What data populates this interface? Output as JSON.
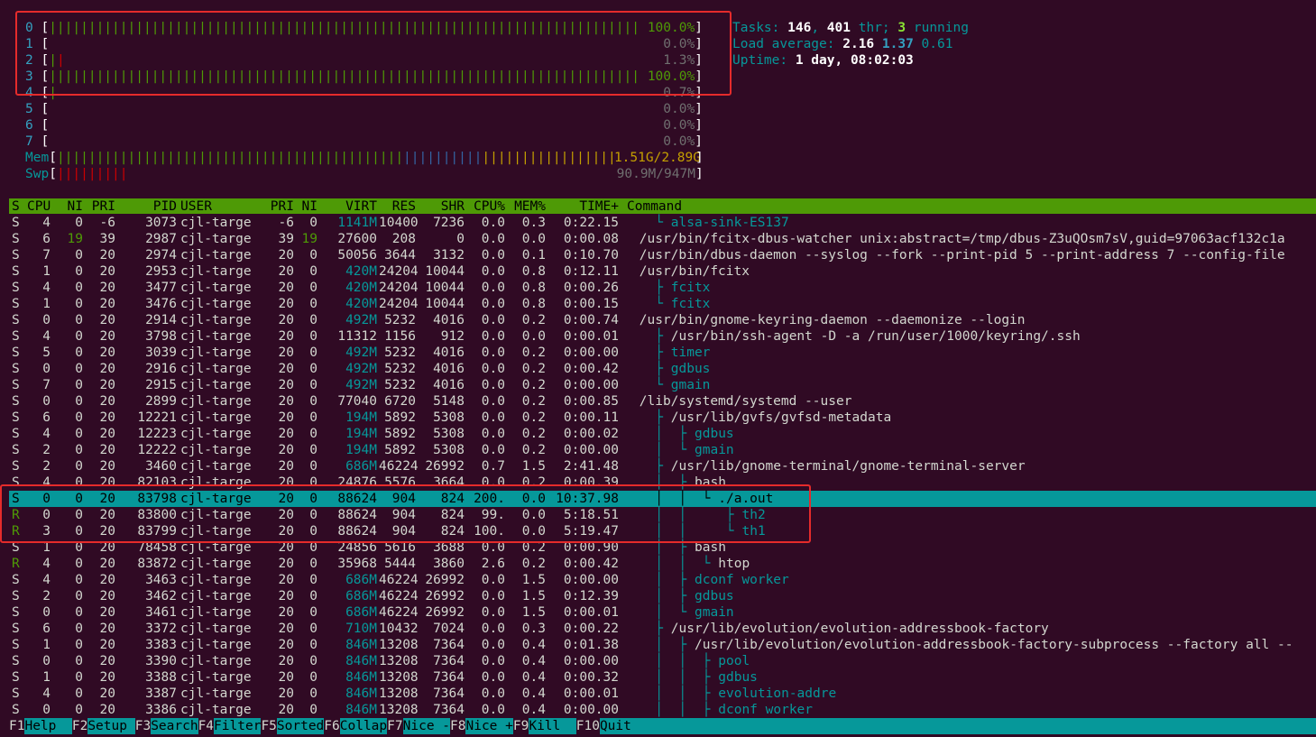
{
  "cpus": [
    {
      "id": "0",
      "pct": "100.0%",
      "fill": 0.99,
      "bar": "||||||||||||||||||||||||||||||||||||||||||||||||||||||||||||||||||||||||||||||||||||||||||||||||||"
    },
    {
      "id": "1",
      "pct": "0.0%",
      "fill": 0,
      "bar": ""
    },
    {
      "id": "2",
      "pct": "1.3%",
      "fill": 0.02,
      "bar": "||"
    },
    {
      "id": "3",
      "pct": "100.0%",
      "fill": 0.99,
      "bar": "||||||||||||||||||||||||||||||||||||||||||||||||||||||||||||||||||||||||||||||||||||||||||||||||||"
    },
    {
      "id": "4",
      "pct": "0.7%",
      "fill": 0.01,
      "bar": "|"
    },
    {
      "id": "5",
      "pct": "0.0%",
      "fill": 0,
      "bar": ""
    },
    {
      "id": "6",
      "pct": "0.0%",
      "fill": 0,
      "bar": ""
    },
    {
      "id": "7",
      "pct": "0.0%",
      "fill": 0,
      "bar": ""
    }
  ],
  "mem": {
    "label": "Mem",
    "value": "1.51G/2.89G",
    "fill": 0.52
  },
  "swp": {
    "label": "Swp",
    "value": "90.9M/947M",
    "fill": 0.1
  },
  "tasks": {
    "label": "Tasks:",
    "count": "146",
    "sep": ", ",
    "thr": "401",
    "thr_label": " thr; ",
    "running": "3",
    "running_label": " running"
  },
  "load": {
    "label": "Load average:",
    "v1": "2.16",
    "v2": "1.37",
    "v3": "0.61"
  },
  "uptime": {
    "label": "Uptime:",
    "value": "1 day, 08:02:03"
  },
  "header": [
    "S",
    "CPU",
    "NI",
    "PRI",
    "PID",
    "USER",
    "PRI",
    "NI",
    "VIRT",
    "RES",
    "SHR",
    "CPU%",
    "MEM%",
    "TIME+",
    "Command"
  ],
  "rows": [
    {
      "s": "S",
      "cpu": "4",
      "ni": "0",
      "pri": "-6",
      "pid": "3073",
      "user": "cjl-targe",
      "pri2": "-6",
      "ni2": "0",
      "virt": "1141M",
      "res": "10400",
      "shr": "7236",
      "cpup": "0.0",
      "memp": "0.3",
      "time": "0:22.15",
      "tree": "   └ ",
      "cmd": "alsa-sink-ES137",
      "cmdc": "cyn"
    },
    {
      "s": "S",
      "cpu": "6",
      "ni": "19",
      "pri": "39",
      "pid": "2987",
      "user": "cjl-targe",
      "pri2": "39",
      "ni2": "19",
      "virt": "27600",
      "res": "208",
      "shr": "0",
      "cpup": "0.0",
      "memp": "0.0",
      "time": "0:00.08",
      "tree": " ",
      "cmd": "/usr/bin/fcitx-dbus-watcher unix:abstract=/tmp/dbus-Z3uQOsm7sV,guid=97063acf132c1a",
      "cmdc": ""
    },
    {
      "s": "S",
      "cpu": "7",
      "ni": "0",
      "pri": "20",
      "pid": "2974",
      "user": "cjl-targe",
      "pri2": "20",
      "ni2": "0",
      "virt": "50056",
      "res": "3644",
      "shr": "3132",
      "cpup": "0.0",
      "memp": "0.1",
      "time": "0:10.70",
      "tree": " ",
      "cmd": "/usr/bin/dbus-daemon --syslog --fork --print-pid 5 --print-address 7 --config-file",
      "cmdc": ""
    },
    {
      "s": "S",
      "cpu": "1",
      "ni": "0",
      "pri": "20",
      "pid": "2953",
      "user": "cjl-targe",
      "pri2": "20",
      "ni2": "0",
      "virt": "420M",
      "res": "24204",
      "shr": "10044",
      "cpup": "0.0",
      "memp": "0.8",
      "time": "0:12.11",
      "tree": " ",
      "cmd": "/usr/bin/fcitx",
      "cmdc": ""
    },
    {
      "s": "S",
      "cpu": "4",
      "ni": "0",
      "pri": "20",
      "pid": "3477",
      "user": "cjl-targe",
      "pri2": "20",
      "ni2": "0",
      "virt": "420M",
      "res": "24204",
      "shr": "10044",
      "cpup": "0.0",
      "memp": "0.8",
      "time": "0:00.26",
      "tree": "   ├ ",
      "cmd": "fcitx",
      "cmdc": "cyn"
    },
    {
      "s": "S",
      "cpu": "1",
      "ni": "0",
      "pri": "20",
      "pid": "3476",
      "user": "cjl-targe",
      "pri2": "20",
      "ni2": "0",
      "virt": "420M",
      "res": "24204",
      "shr": "10044",
      "cpup": "0.0",
      "memp": "0.8",
      "time": "0:00.15",
      "tree": "   └ ",
      "cmd": "fcitx",
      "cmdc": "cyn"
    },
    {
      "s": "S",
      "cpu": "0",
      "ni": "0",
      "pri": "20",
      "pid": "2914",
      "user": "cjl-targe",
      "pri2": "20",
      "ni2": "0",
      "virt": "492M",
      "res": "5232",
      "shr": "4016",
      "cpup": "0.0",
      "memp": "0.2",
      "time": "0:00.74",
      "tree": " ",
      "cmd": "/usr/bin/gnome-keyring-daemon --daemonize --login",
      "cmdc": ""
    },
    {
      "s": "S",
      "cpu": "4",
      "ni": "0",
      "pri": "20",
      "pid": "3798",
      "user": "cjl-targe",
      "pri2": "20",
      "ni2": "0",
      "virt": "11312",
      "res": "1156",
      "shr": "912",
      "cpup": "0.0",
      "memp": "0.0",
      "time": "0:00.01",
      "tree": "   ├ ",
      "cmd": "/usr/bin/ssh-agent -D -a /run/user/1000/keyring/.ssh",
      "cmdc": ""
    },
    {
      "s": "S",
      "cpu": "5",
      "ni": "0",
      "pri": "20",
      "pid": "3039",
      "user": "cjl-targe",
      "pri2": "20",
      "ni2": "0",
      "virt": "492M",
      "res": "5232",
      "shr": "4016",
      "cpup": "0.0",
      "memp": "0.2",
      "time": "0:00.00",
      "tree": "   ├ ",
      "cmd": "timer",
      "cmdc": "cyn"
    },
    {
      "s": "S",
      "cpu": "0",
      "ni": "0",
      "pri": "20",
      "pid": "2916",
      "user": "cjl-targe",
      "pri2": "20",
      "ni2": "0",
      "virt": "492M",
      "res": "5232",
      "shr": "4016",
      "cpup": "0.0",
      "memp": "0.2",
      "time": "0:00.42",
      "tree": "   ├ ",
      "cmd": "gdbus",
      "cmdc": "cyn"
    },
    {
      "s": "S",
      "cpu": "7",
      "ni": "0",
      "pri": "20",
      "pid": "2915",
      "user": "cjl-targe",
      "pri2": "20",
      "ni2": "0",
      "virt": "492M",
      "res": "5232",
      "shr": "4016",
      "cpup": "0.0",
      "memp": "0.2",
      "time": "0:00.00",
      "tree": "   └ ",
      "cmd": "gmain",
      "cmdc": "cyn"
    },
    {
      "s": "S",
      "cpu": "0",
      "ni": "0",
      "pri": "20",
      "pid": "2899",
      "user": "cjl-targe",
      "pri2": "20",
      "ni2": "0",
      "virt": "77040",
      "res": "6720",
      "shr": "5148",
      "cpup": "0.0",
      "memp": "0.2",
      "time": "0:00.85",
      "tree": " ",
      "cmd": "/lib/systemd/systemd --user",
      "cmdc": ""
    },
    {
      "s": "S",
      "cpu": "6",
      "ni": "0",
      "pri": "20",
      "pid": "12221",
      "user": "cjl-targe",
      "pri2": "20",
      "ni2": "0",
      "virt": "194M",
      "res": "5892",
      "shr": "5308",
      "cpup": "0.0",
      "memp": "0.2",
      "time": "0:00.11",
      "tree": "   ├ ",
      "cmd": "/usr/lib/gvfs/gvfsd-metadata",
      "cmdc": ""
    },
    {
      "s": "S",
      "cpu": "4",
      "ni": "0",
      "pri": "20",
      "pid": "12223",
      "user": "cjl-targe",
      "pri2": "20",
      "ni2": "0",
      "virt": "194M",
      "res": "5892",
      "shr": "5308",
      "cpup": "0.0",
      "memp": "0.2",
      "time": "0:00.02",
      "tree": "   │  ├ ",
      "cmd": "gdbus",
      "cmdc": "cyn"
    },
    {
      "s": "S",
      "cpu": "2",
      "ni": "0",
      "pri": "20",
      "pid": "12222",
      "user": "cjl-targe",
      "pri2": "20",
      "ni2": "0",
      "virt": "194M",
      "res": "5892",
      "shr": "5308",
      "cpup": "0.0",
      "memp": "0.2",
      "time": "0:00.00",
      "tree": "   │  └ ",
      "cmd": "gmain",
      "cmdc": "cyn"
    },
    {
      "s": "S",
      "cpu": "2",
      "ni": "0",
      "pri": "20",
      "pid": "3460",
      "user": "cjl-targe",
      "pri2": "20",
      "ni2": "0",
      "virt": "686M",
      "res": "46224",
      "shr": "26992",
      "cpup": "0.7",
      "memp": "1.5",
      "time": "2:41.48",
      "tree": "   ├ ",
      "cmd": "/usr/lib/gnome-terminal/gnome-terminal-server",
      "cmdc": ""
    },
    {
      "s": "S",
      "cpu": "4",
      "ni": "0",
      "pri": "20",
      "pid": "82103",
      "user": "cjl-targe",
      "pri2": "20",
      "ni2": "0",
      "virt": "24876",
      "res": "5576",
      "shr": "3664",
      "cpup": "0.0",
      "memp": "0.2",
      "time": "0:00.39",
      "tree": "   │  ├ ",
      "cmd": "bash",
      "cmdc": "",
      "strike": true
    },
    {
      "s": "S",
      "cpu": "0",
      "ni": "0",
      "pri": "20",
      "pid": "83798",
      "user": "cjl-targe",
      "pri2": "20",
      "ni2": "0",
      "virt": "88624",
      "res": "904",
      "shr": "824",
      "cpup": "200.",
      "memp": "0.0",
      "time": "10:37.98",
      "tree": "   │  │  └ ",
      "cmd": "./a.out",
      "cmdc": "",
      "sel": true
    },
    {
      "s": "R",
      "cpu": "0",
      "ni": "0",
      "pri": "20",
      "pid": "83800",
      "user": "cjl-targe",
      "pri2": "20",
      "ni2": "0",
      "virt": "88624",
      "res": "904",
      "shr": "824",
      "cpup": "99.",
      "memp": "0.0",
      "time": "5:18.51",
      "tree": "   │  │     ├ ",
      "cmd": "th2",
      "cmdc": "cyn"
    },
    {
      "s": "R",
      "cpu": "3",
      "ni": "0",
      "pri": "20",
      "pid": "83799",
      "user": "cjl-targe",
      "pri2": "20",
      "ni2": "0",
      "virt": "88624",
      "res": "904",
      "shr": "824",
      "cpup": "100.",
      "memp": "0.0",
      "time": "5:19.47",
      "tree": "   │  │     └ ",
      "cmd": "th1",
      "cmdc": "cyn"
    },
    {
      "s": "S",
      "cpu": "1",
      "ni": "0",
      "pri": "20",
      "pid": "78458",
      "user": "cjl-targe",
      "pri2": "20",
      "ni2": "0",
      "virt": "24856",
      "res": "5616",
      "shr": "3688",
      "cpup": "0.0",
      "memp": "0.2",
      "time": "0:00.90",
      "tree": "   │  ├ ",
      "cmd": "bash",
      "cmdc": ""
    },
    {
      "s": "R",
      "cpu": "4",
      "ni": "0",
      "pri": "20",
      "pid": "83872",
      "user": "cjl-targe",
      "pri2": "20",
      "ni2": "0",
      "virt": "35968",
      "res": "5444",
      "shr": "3860",
      "cpup": "2.6",
      "memp": "0.2",
      "time": "0:00.42",
      "tree": "   │  │  └ ",
      "cmd": "htop",
      "cmdc": ""
    },
    {
      "s": "S",
      "cpu": "4",
      "ni": "0",
      "pri": "20",
      "pid": "3463",
      "user": "cjl-targe",
      "pri2": "20",
      "ni2": "0",
      "virt": "686M",
      "res": "46224",
      "shr": "26992",
      "cpup": "0.0",
      "memp": "1.5",
      "time": "0:00.00",
      "tree": "   │  ├ ",
      "cmd": "dconf worker",
      "cmdc": "cyn"
    },
    {
      "s": "S",
      "cpu": "2",
      "ni": "0",
      "pri": "20",
      "pid": "3462",
      "user": "cjl-targe",
      "pri2": "20",
      "ni2": "0",
      "virt": "686M",
      "res": "46224",
      "shr": "26992",
      "cpup": "0.0",
      "memp": "1.5",
      "time": "0:12.39",
      "tree": "   │  ├ ",
      "cmd": "gdbus",
      "cmdc": "cyn"
    },
    {
      "s": "S",
      "cpu": "0",
      "ni": "0",
      "pri": "20",
      "pid": "3461",
      "user": "cjl-targe",
      "pri2": "20",
      "ni2": "0",
      "virt": "686M",
      "res": "46224",
      "shr": "26992",
      "cpup": "0.0",
      "memp": "1.5",
      "time": "0:00.01",
      "tree": "   │  └ ",
      "cmd": "gmain",
      "cmdc": "cyn"
    },
    {
      "s": "S",
      "cpu": "6",
      "ni": "0",
      "pri": "20",
      "pid": "3372",
      "user": "cjl-targe",
      "pri2": "20",
      "ni2": "0",
      "virt": "710M",
      "res": "10432",
      "shr": "7024",
      "cpup": "0.0",
      "memp": "0.3",
      "time": "0:00.22",
      "tree": "   ├ ",
      "cmd": "/usr/lib/evolution/evolution-addressbook-factory",
      "cmdc": ""
    },
    {
      "s": "S",
      "cpu": "1",
      "ni": "0",
      "pri": "20",
      "pid": "3383",
      "user": "cjl-targe",
      "pri2": "20",
      "ni2": "0",
      "virt": "846M",
      "res": "13208",
      "shr": "7364",
      "cpup": "0.0",
      "memp": "0.4",
      "time": "0:01.38",
      "tree": "   │  ├ ",
      "cmd": "/usr/lib/evolution/evolution-addressbook-factory-subprocess --factory all --",
      "cmdc": ""
    },
    {
      "s": "S",
      "cpu": "0",
      "ni": "0",
      "pri": "20",
      "pid": "3390",
      "user": "cjl-targe",
      "pri2": "20",
      "ni2": "0",
      "virt": "846M",
      "res": "13208",
      "shr": "7364",
      "cpup": "0.0",
      "memp": "0.4",
      "time": "0:00.00",
      "tree": "   │  │  ├ ",
      "cmd": "pool",
      "cmdc": "cyn"
    },
    {
      "s": "S",
      "cpu": "1",
      "ni": "0",
      "pri": "20",
      "pid": "3388",
      "user": "cjl-targe",
      "pri2": "20",
      "ni2": "0",
      "virt": "846M",
      "res": "13208",
      "shr": "7364",
      "cpup": "0.0",
      "memp": "0.4",
      "time": "0:00.32",
      "tree": "   │  │  ├ ",
      "cmd": "gdbus",
      "cmdc": "cyn"
    },
    {
      "s": "S",
      "cpu": "4",
      "ni": "0",
      "pri": "20",
      "pid": "3387",
      "user": "cjl-targe",
      "pri2": "20",
      "ni2": "0",
      "virt": "846M",
      "res": "13208",
      "shr": "7364",
      "cpup": "0.0",
      "memp": "0.4",
      "time": "0:00.01",
      "tree": "   │  │  ├ ",
      "cmd": "evolution-addre",
      "cmdc": "cyn"
    },
    {
      "s": "S",
      "cpu": "0",
      "ni": "0",
      "pri": "20",
      "pid": "3386",
      "user": "cjl-targe",
      "pri2": "20",
      "ni2": "0",
      "virt": "846M",
      "res": "13208",
      "shr": "7364",
      "cpup": "0.0",
      "memp": "0.4",
      "time": "0:00.00",
      "tree": "   │  │  ├ ",
      "cmd": "dconf worker",
      "cmdc": "cyn"
    }
  ],
  "footer": [
    {
      "key": "F1",
      "label": "Help  "
    },
    {
      "key": "F2",
      "label": "Setup "
    },
    {
      "key": "F3",
      "label": "Search"
    },
    {
      "key": "F4",
      "label": "Filter"
    },
    {
      "key": "F5",
      "label": "Sorted"
    },
    {
      "key": "F6",
      "label": "Collap"
    },
    {
      "key": "F7",
      "label": "Nice -"
    },
    {
      "key": "F8",
      "label": "Nice +"
    },
    {
      "key": "F9",
      "label": "Kill  "
    },
    {
      "key": "F10",
      "label": "Quit"
    }
  ],
  "colors": {
    "bg": "#300a24",
    "header": "#4e9a06",
    "selected": "#06989a",
    "annotation": "#e52b2b"
  }
}
